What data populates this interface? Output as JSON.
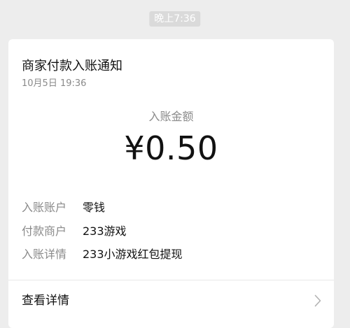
{
  "timestamp": "晚上7:36",
  "notification": {
    "title": "商家付款入账通知",
    "date": "10月5日  19:36",
    "amount_label": "入账金额",
    "amount": "¥0.50",
    "details": [
      {
        "key": "入账账户",
        "value": "零钱"
      },
      {
        "key": "付款商户",
        "value": "233游戏"
      },
      {
        "key": "入账详情",
        "value": "233小游戏红包提现"
      }
    ],
    "footer_link": "查看详情"
  },
  "icons": {
    "footer_chevron": "chevron-right-icon"
  },
  "colors": {
    "background": "#ededed",
    "card": "#ffffff",
    "secondary_text": "#8a8a8a",
    "primary_text": "#111111"
  }
}
